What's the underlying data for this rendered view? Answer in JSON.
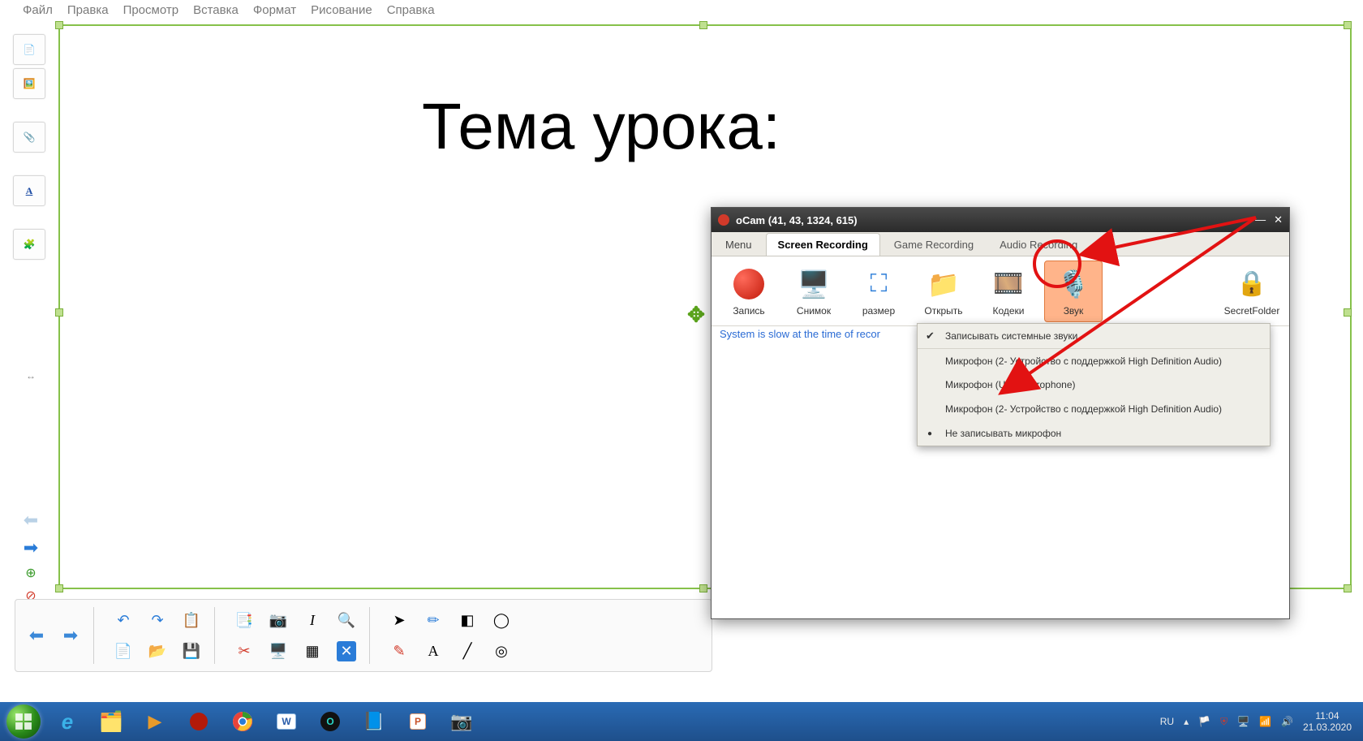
{
  "menu": {
    "items": [
      "Файл",
      "Правка",
      "Просмотр",
      "Вставка",
      "Формат",
      "Рисование",
      "Справка"
    ]
  },
  "slide": {
    "title": "Тема урока:"
  },
  "ocam": {
    "title": "oCam (41, 43, 1324, 615)",
    "tabs": {
      "menu": "Menu",
      "screen": "Screen Recording",
      "game": "Game Recording",
      "audio": "Audio Recording"
    },
    "buttons": {
      "record": "Запись",
      "capture": "Снимок",
      "resize": "размер",
      "open": "Открыть",
      "codecs": "Кодеки",
      "sound": "Звук",
      "secret": "SecretFolder"
    },
    "status": "System is slow at the time of recor"
  },
  "sound_menu": {
    "items": [
      "Записывать системные звуки",
      "Микрофон (2- Устройство с поддержкой High Definition Audio)",
      "Микрофон (USB Microphone)",
      "Микрофон (2- Устройство с поддержкой High Definition Audio)",
      "Не записывать микрофон"
    ]
  },
  "taskbar": {
    "lang": "RU",
    "time": "11:04",
    "date": "21.03.2020"
  }
}
